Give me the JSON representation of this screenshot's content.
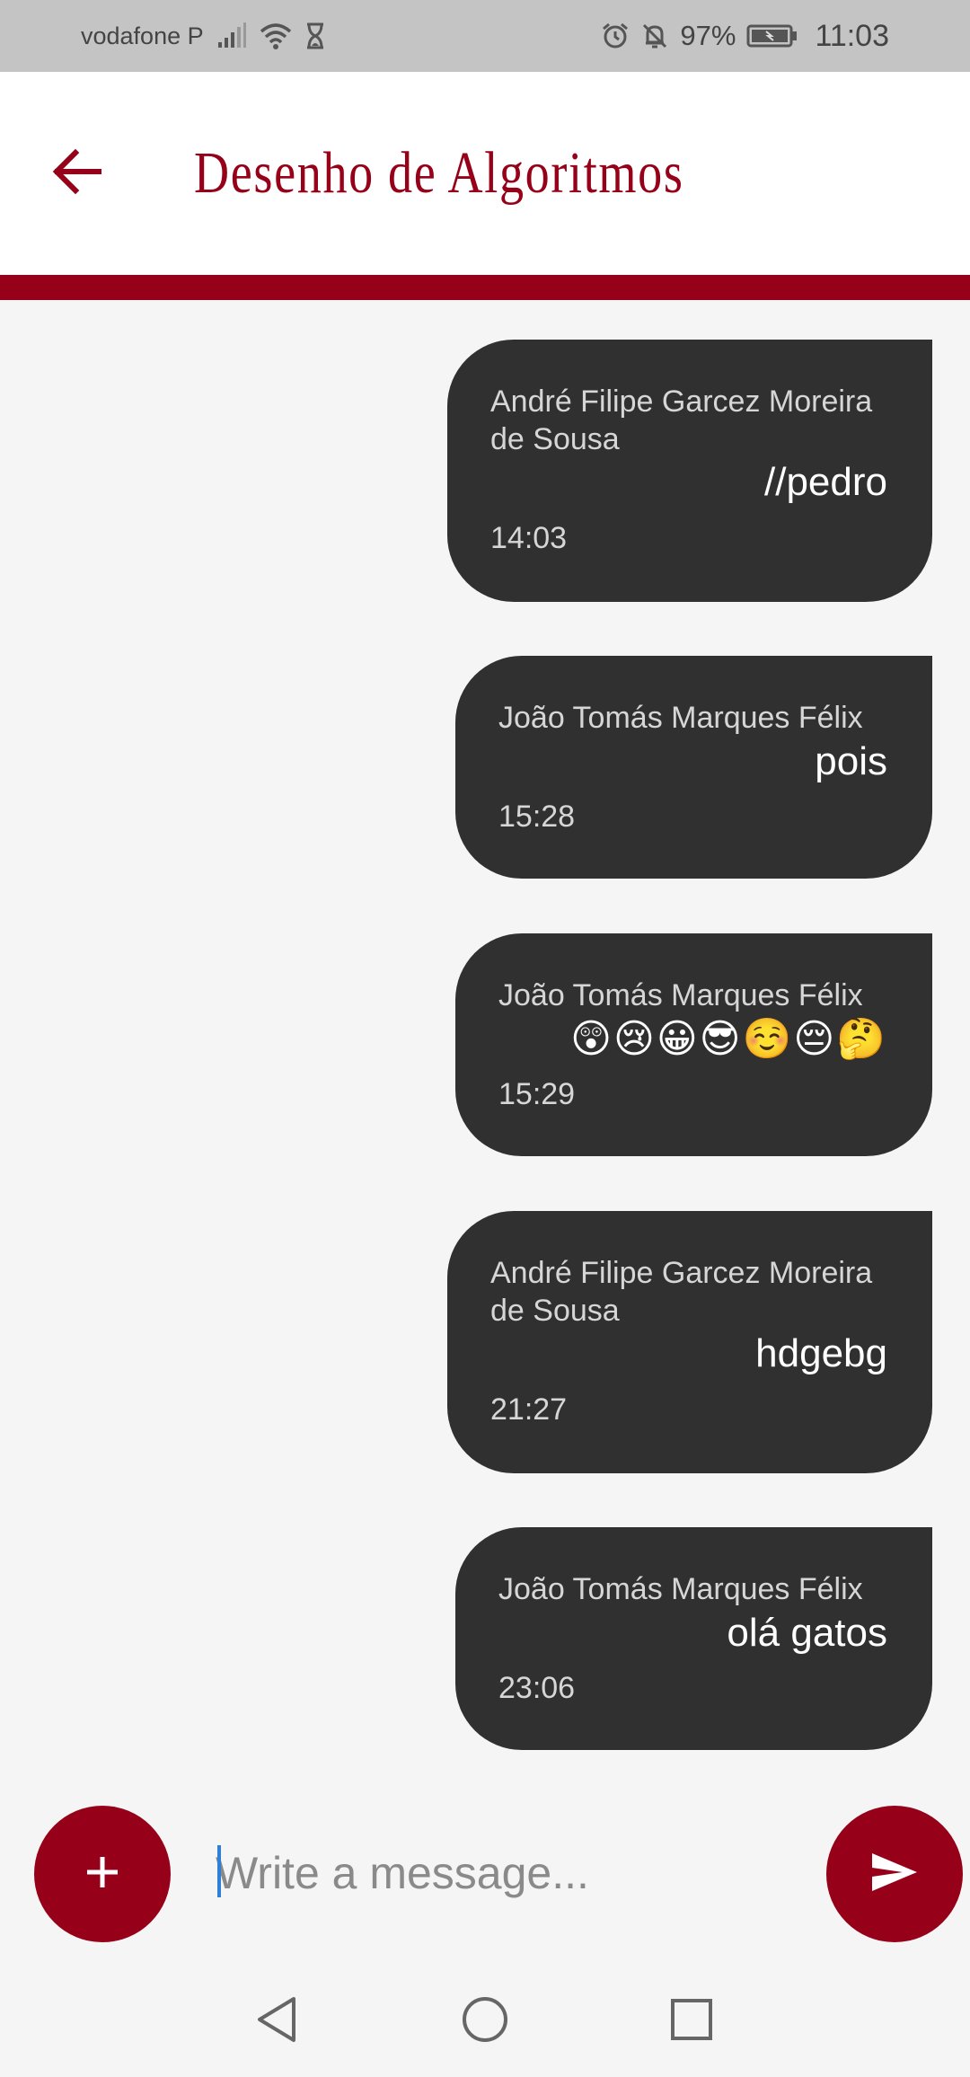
{
  "status_bar": {
    "carrier": "vodafone P",
    "battery": "97%",
    "time": "11:03",
    "icons": [
      "signal-icon",
      "wifi-icon",
      "hourglass-icon",
      "alarm-icon",
      "bell-off-icon",
      "battery-icon"
    ]
  },
  "app_bar": {
    "title": "Desenho de Algoritmos",
    "back_icon": "arrow-left-icon",
    "accent_color": "#960018"
  },
  "messages": [
    {
      "sender": "André Filipe Garcez Moreira de Sousa",
      "text": "//pedro",
      "time": "14:03"
    },
    {
      "sender": "João Tomás Marques Félix",
      "text": "pois",
      "time": "15:28"
    },
    {
      "sender": "João Tomás Marques Félix",
      "text": "😲😢😀😎☺️😔🤔",
      "time": "15:29"
    },
    {
      "sender": "André Filipe Garcez Moreira de Sousa",
      "text": "hdgebg",
      "time": "21:27"
    },
    {
      "sender": "João Tomás Marques Félix",
      "text": "olá gatos",
      "time": "23:06"
    }
  ],
  "composer": {
    "placeholder": "Write a message...",
    "value": "",
    "add_icon": "plus-icon",
    "send_icon": "send-icon"
  },
  "nav_bar": {
    "icons": [
      "back-triangle-icon",
      "home-circle-icon",
      "recents-square-icon"
    ]
  },
  "colors": {
    "bubble": "#303030",
    "background": "#f5f5f5",
    "status_bar": "#c4c4c4"
  }
}
